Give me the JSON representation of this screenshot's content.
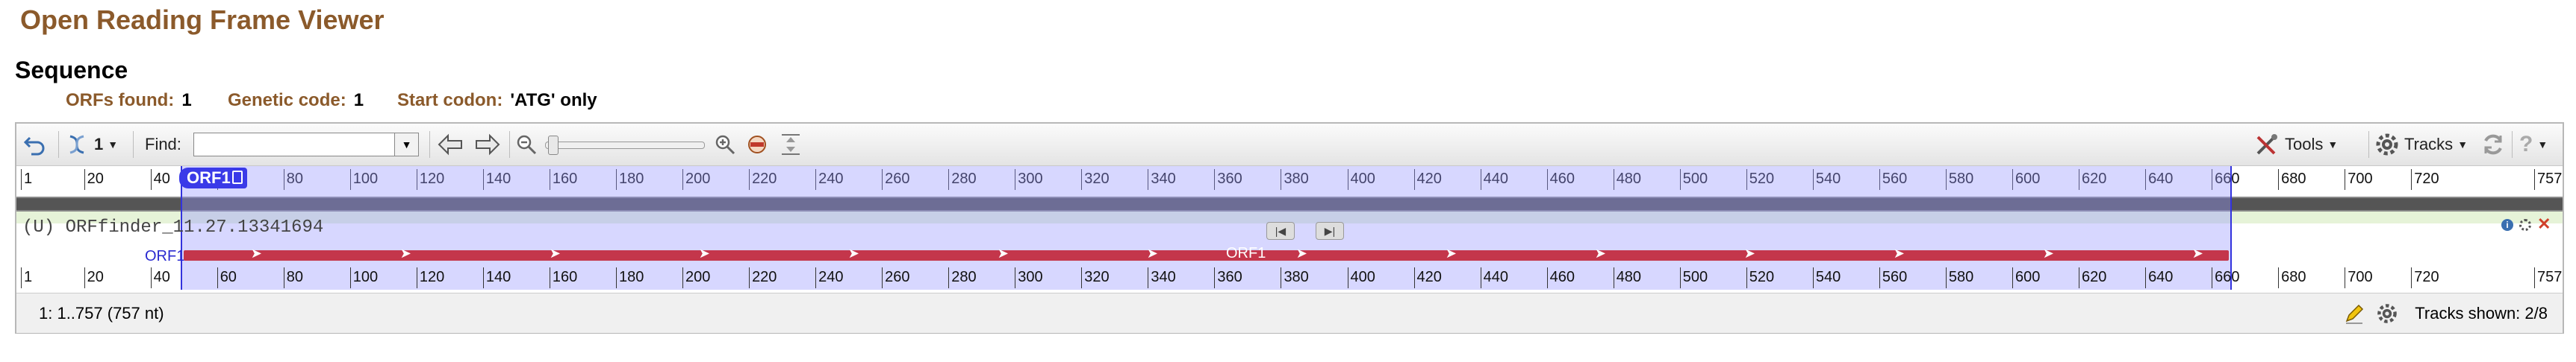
{
  "app": {
    "title": "Open Reading Frame Viewer"
  },
  "section": {
    "title": "Sequence"
  },
  "summary": [
    {
      "key": "ORFs found:",
      "value": "1"
    },
    {
      "key": "Genetic code:",
      "value": "1"
    },
    {
      "key": "Start codon:",
      "value": "'ATG' only"
    }
  ],
  "toolbar": {
    "strand_value": "1",
    "find_label": "Find:",
    "find_value": "",
    "tools_label": "Tools",
    "tracks_label": "Tracks"
  },
  "ruler_top": {
    "ticks": [
      "1",
      "20",
      "40",
      "60",
      "80",
      "100",
      "120",
      "140",
      "160",
      "180",
      "200",
      "220",
      "240",
      "260",
      "280",
      "300",
      "320",
      "340",
      "360",
      "380",
      "400",
      "420",
      "440",
      "460",
      "480",
      "500",
      "520",
      "540",
      "560",
      "580",
      "600",
      "620",
      "640",
      "660",
      "680",
      "700",
      "720",
      "757"
    ]
  },
  "ruler_bottom": {
    "ticks": [
      "1",
      "20",
      "40",
      "60",
      "80",
      "100",
      "120",
      "140",
      "160",
      "180",
      "200",
      "220",
      "240",
      "260",
      "280",
      "300",
      "320",
      "340",
      "360",
      "380",
      "400",
      "420",
      "440",
      "460",
      "480",
      "500",
      "520",
      "540",
      "560",
      "580",
      "600",
      "620",
      "640",
      "660",
      "680",
      "700",
      "720",
      "757"
    ]
  },
  "orf": {
    "label": "ORF1",
    "bar_label": "ORF1",
    "row_label": "ORF1",
    "start": 49,
    "end": 666,
    "seq_length": 757
  },
  "track": {
    "name": "(U) ORFfinder_11.27.13341694"
  },
  "status": {
    "range": "1: 1..757 (757 nt)",
    "tracks_shown": "Tracks shown: 2/8"
  }
}
